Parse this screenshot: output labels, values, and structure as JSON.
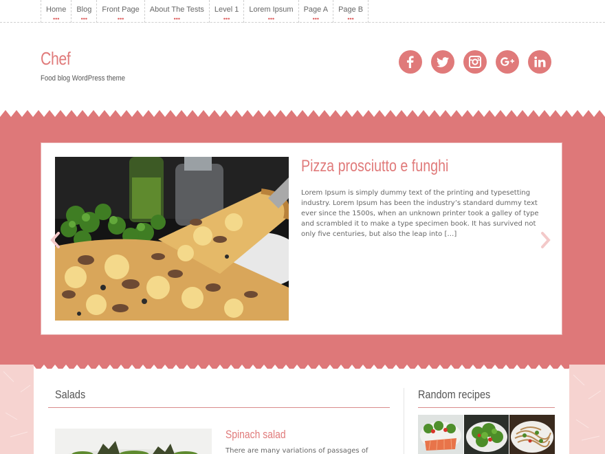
{
  "nav": {
    "items": [
      {
        "label": "Home"
      },
      {
        "label": "Blog"
      },
      {
        "label": "Front Page"
      },
      {
        "label": "About The Tests"
      },
      {
        "label": "Level 1"
      },
      {
        "label": "Lorem Ipsum"
      },
      {
        "label": "Page A"
      },
      {
        "label": "Page B"
      }
    ],
    "dots": "•••"
  },
  "site": {
    "title": "Chef",
    "tagline": "Food blog WordPress theme"
  },
  "social": [
    {
      "icon": "facebook-icon",
      "glyph": "f"
    },
    {
      "icon": "twitter-icon",
      "glyph": "t"
    },
    {
      "icon": "instagram-icon",
      "glyph": "◎"
    },
    {
      "icon": "google-plus-icon",
      "glyph": "g+"
    },
    {
      "icon": "linkedin-icon",
      "glyph": "in"
    }
  ],
  "slider": {
    "title": "Pizza prosciutto e funghi",
    "excerpt": "Lorem Ipsum is simply dummy text of the printing and typesetting industry. Lorem Ipsum has been the industry’s standard dummy text ever since the 1500s, when an unknown printer took a galley of type and scrambled it to make a type specimen book. It has survived not only five centuries, but also the leap into […]",
    "prev_icon": "chevron-left-icon",
    "next_icon": "chevron-right-icon"
  },
  "main": {
    "section_title": "Salads",
    "post": {
      "title": "Spinach salad",
      "excerpt": "There are many variations of passages of"
    }
  },
  "sidebar": {
    "widget_title": "Random recipes"
  },
  "colors": {
    "accent": "#e07a7a",
    "band": "#de7879",
    "paper": "#f6d3d0",
    "text": "#555555"
  }
}
